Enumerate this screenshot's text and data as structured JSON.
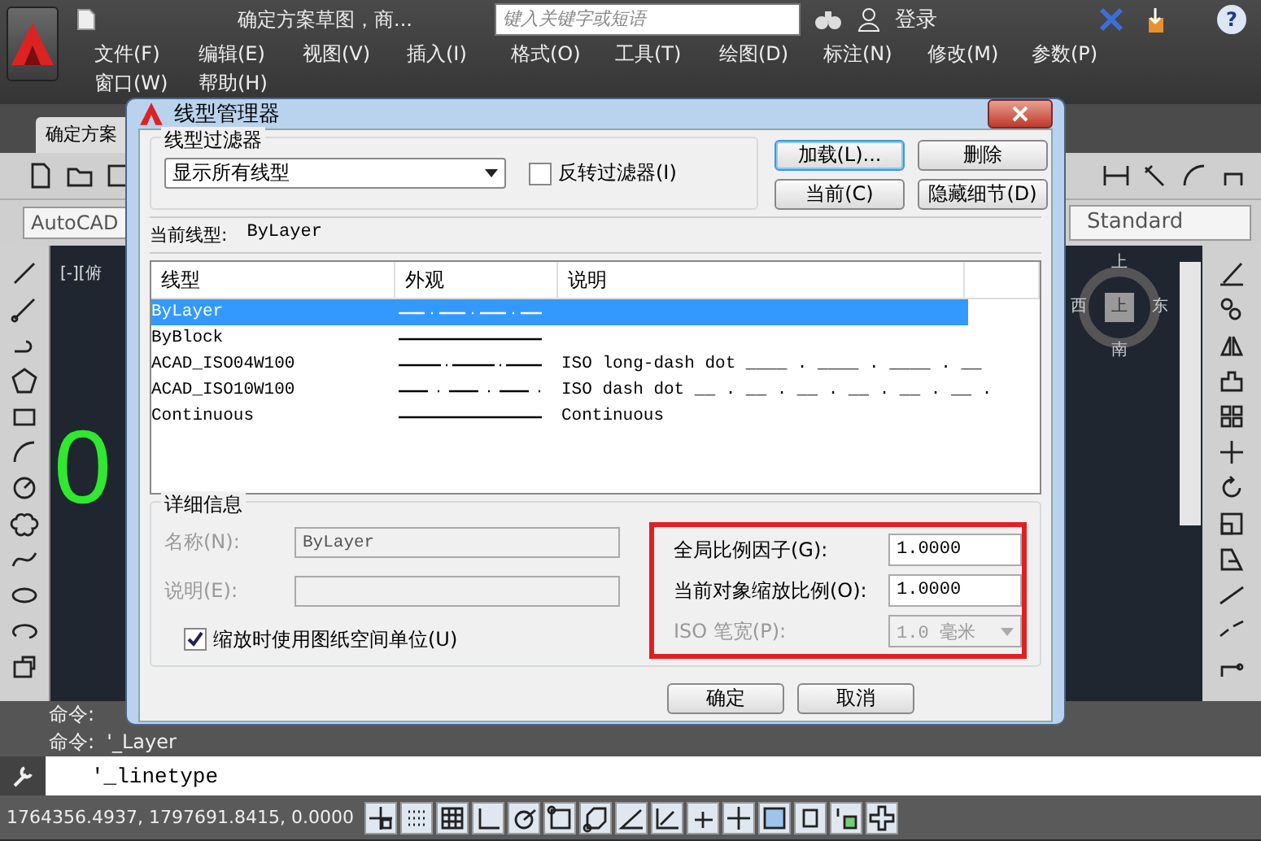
{
  "app": {
    "title": "确定方案草图，商...",
    "search": {
      "placeholder": "键入关键字或短语"
    },
    "user": "登录",
    "help": "?"
  },
  "menu": [
    {
      "label": "文件(F)"
    },
    {
      "label": "编辑(E)"
    },
    {
      "label": "视图(V)"
    },
    {
      "label": "插入(I)"
    },
    {
      "label": "格式(O)"
    },
    {
      "label": "工具(T)"
    },
    {
      "label": "绘图(D)"
    },
    {
      "label": "标注(N)"
    },
    {
      "label": "修改(M)"
    },
    {
      "label": "参数(P)"
    },
    {
      "label": "窗口(W)"
    },
    {
      "label": "帮助(H)"
    }
  ],
  "document_tab": "确定方案",
  "toolbar": {
    "workspace": "AutoCAD",
    "style": "Standard"
  },
  "viewport": {
    "label": "[-][俯",
    "drawing_text": "0",
    "viewcube": {
      "north": "上",
      "west": "西",
      "face": "上",
      "east": "东",
      "south": "南"
    }
  },
  "command": {
    "history": [
      "命令:",
      "命令:  '_Layer"
    ],
    "input": "'_linetype"
  },
  "status_bar": {
    "coordinates": "1764356.4937, 1797691.8415, 0.0000"
  },
  "dialog": {
    "title": "线型管理器",
    "filter": {
      "label": "线型过滤器",
      "value": "显示所有线型",
      "invert": {
        "label": "反转过滤器(I)",
        "checked": false
      }
    },
    "buttons": [
      {
        "label": "加载(L)...",
        "focused": true
      },
      {
        "label": "删除",
        "focused": false
      },
      {
        "label": "当前(C)",
        "focused": false
      },
      {
        "label": "隐藏细节(D)",
        "focused": false
      }
    ],
    "current": {
      "label": "当前线型:",
      "value": "ByLayer"
    },
    "table": {
      "columns": [
        "线型",
        "外观",
        "说明"
      ],
      "rows": [
        {
          "name": "ByLayer",
          "kind": "bylayer",
          "description": "",
          "selected": true
        },
        {
          "name": "ByBlock",
          "kind": "solid",
          "description": "",
          "selected": false
        },
        {
          "name": "ACAD_ISO04W100",
          "kind": "longdashdot",
          "description": "ISO long-dash dot ____ . ____ . ____ . __",
          "selected": false
        },
        {
          "name": "ACAD_ISO10W100",
          "kind": "dashdot",
          "description": "ISO dash dot __ . __ . __ . __ . __ . __ .",
          "selected": false
        },
        {
          "name": "Continuous",
          "kind": "solid",
          "description": "Continuous",
          "selected": false
        }
      ]
    },
    "details": {
      "label": "详细信息",
      "name": {
        "label": "名称(N):",
        "value": "ByLayer",
        "disabled": true
      },
      "description": {
        "label": "说明(E):",
        "disabled": true
      },
      "paper_space_units": {
        "label": "缩放时使用图纸空间单位(U)",
        "checked": true
      },
      "global_scale": {
        "label": "全局比例因子(G):",
        "value": "1.0000"
      },
      "current_scale": {
        "label": "当前对象缩放比例(O):",
        "value": "1.0000"
      },
      "pen_width": {
        "label": "ISO 笔宽(P):",
        "value": "1.0 毫米",
        "disabled": true
      }
    },
    "footer": [
      {
        "label": "确定"
      },
      {
        "label": "取消"
      }
    ]
  }
}
